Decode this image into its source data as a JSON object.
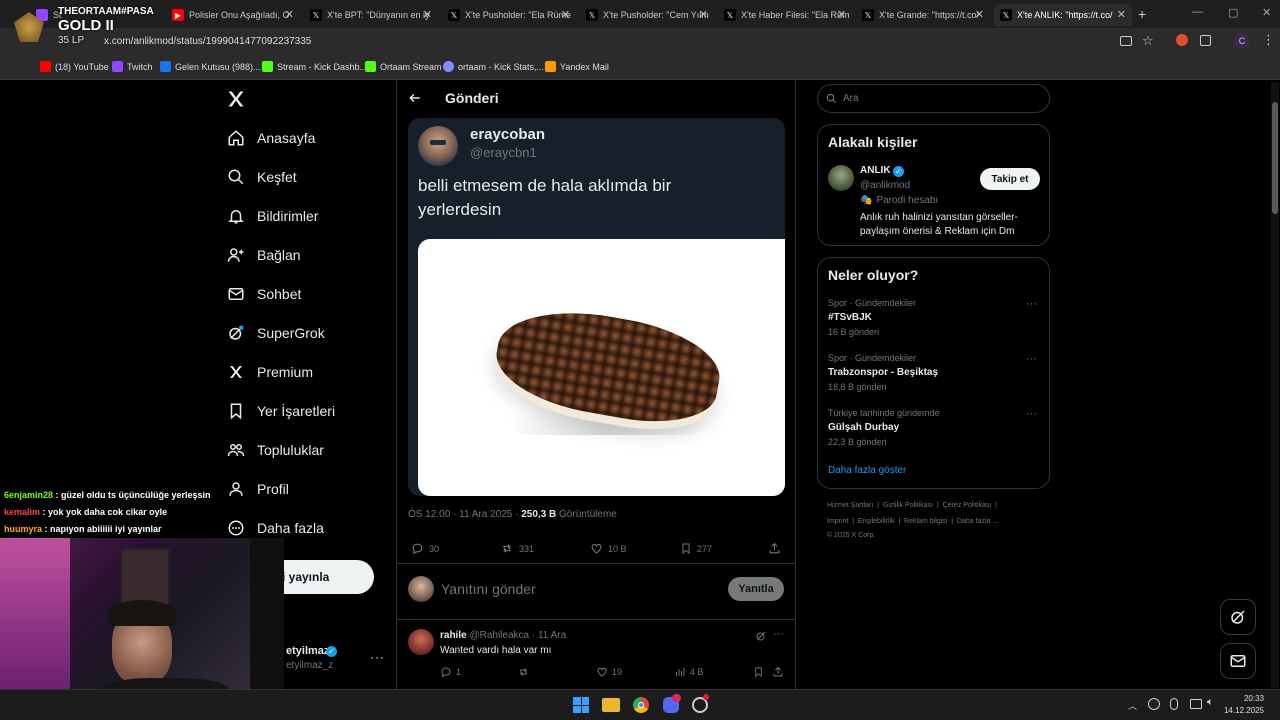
{
  "browser": {
    "tabs": [
      {
        "label": "St",
        "favicon_color": "#9146ff"
      },
      {
        "label": "Polisler Onu Aşağıladı, O",
        "favicon_color": "#ff0000"
      },
      {
        "label": "X'te BPT: \"Dünyanın en iy",
        "favicon_color": "#000000"
      },
      {
        "label": "X'te Pusholder: \"Ela Rüme",
        "favicon_color": "#000000"
      },
      {
        "label": "X'te Pusholder: \"Cem Yılm",
        "favicon_color": "#000000"
      },
      {
        "label": "X'te Haber Filesi: \"Ela Rüm",
        "favicon_color": "#000000"
      },
      {
        "label": "X'te Grande: \"https://t.co/",
        "favicon_color": "#000000"
      },
      {
        "label": "X'te ANLIK: \"https://t.co/",
        "favicon_color": "#000000"
      }
    ],
    "url": "x.com/anlikmod/status/1999041477092237335",
    "bookmarks": [
      {
        "label": "(18) YouTube",
        "color": "#ff0000"
      },
      {
        "label": "Twitch",
        "color": "#9146ff"
      },
      {
        "label": "Gelen Kutusu (988)...",
        "color": "#1a73e8"
      },
      {
        "label": "Stream - Kick Dashb...",
        "color": "#53fc18"
      },
      {
        "label": "Ortaam Stream",
        "color": "#53fc18"
      },
      {
        "label": "ortaam - Kick Stats,...",
        "color": "#8888ff"
      },
      {
        "label": "Yandex Mail",
        "color": "#ff9900"
      }
    ]
  },
  "stream_overlay": {
    "streamer": "THEORTAAM#PASA",
    "rank": "GOLD II",
    "lp": "35 LP",
    "chat": [
      {
        "user": "6enjamin28",
        "user_color": "#7CFC00",
        "message": "güzel oldu ts üçüncülüğe yerleşsin"
      },
      {
        "user": "kemalim",
        "user_color": "#ff4040",
        "message": "yok yok daha cok cikar oyle"
      },
      {
        "user": "huumyra",
        "user_color": "#ffb000",
        "message": "napıyon abiiiiii iyi yayınlar"
      }
    ]
  },
  "sidebar": {
    "items": [
      {
        "label": "Anasayfa",
        "icon": "home-icon"
      },
      {
        "label": "Keşfet",
        "icon": "search-icon"
      },
      {
        "label": "Bildirimler",
        "icon": "bell-icon"
      },
      {
        "label": "Bağlan",
        "icon": "person-add-icon"
      },
      {
        "label": "Sohbet",
        "icon": "mail-icon"
      },
      {
        "label": "SuperGrok",
        "icon": "grok-icon"
      },
      {
        "label": "Premium",
        "icon": "x-logo-icon"
      },
      {
        "label": "Yer İşaretleri",
        "icon": "bookmark-icon"
      },
      {
        "label": "Topluluklar",
        "icon": "communities-icon"
      },
      {
        "label": "Profil",
        "icon": "profile-icon"
      },
      {
        "label": "Daha fazla",
        "icon": "more-circle-icon"
      }
    ],
    "post_button": "eri yayınla",
    "account_name": "etyilmaz",
    "account_handle": "etyilmaz_z"
  },
  "post": {
    "header": "Gönderi",
    "author_name": "eraycoban",
    "author_handle": "@eraycbn1",
    "text": "belli etmesem de hala aklımda bir yerlerdesin",
    "time": "ÖS 12:00 · 11 Ara 2025 · ",
    "views": "250,3 B",
    "views_label": "Görüntüleme",
    "replies": "30",
    "reposts": "331",
    "likes": "10 B",
    "bookmarks": "277",
    "reply_placeholder": "Yanıtını gönder",
    "reply_button": "Yanıtla"
  },
  "reply": {
    "name": "rahile",
    "handle": "@Rahileakca",
    "date": "· 11 Ara",
    "text": "Wanted vardı hala var mı",
    "replies": "1",
    "likes": "19",
    "views": "4 B"
  },
  "right": {
    "search_placeholder": "Ara",
    "related_title": "Alakalı kişiler",
    "person_name": "ANLIK",
    "person_handle": "@anlikmod",
    "person_label": "Parodi hesabı",
    "person_bio": "Anlık ruh halinizi yansıtan görseller- paylaşım önerisi & Reklam için Dm",
    "follow_button": "Takip et",
    "trends_title": "Neler oluyor?",
    "trends": [
      {
        "category": "Spor · Gündemdekiler",
        "name": "#TSvBJK",
        "count": "16 B gönderi"
      },
      {
        "category": "Spor · Gündemdekiler",
        "name": "Trabzonspor - Beşiktaş",
        "count": "18,8 B gönderi"
      },
      {
        "category": "Türkiye tarihinde gündemde",
        "name": "Gülşah Durbay",
        "count": "22,3 B gönderi"
      }
    ],
    "show_more": "Daha fazla göster",
    "footer_line1": "Hizmet Şartları  |  Gizlilik Politikası  |  Çerez Politikası  |",
    "footer_line2": "Imprint  |  Erişilebilirlik  |  Reklam bilgisi  |  Daha fazla ...",
    "footer_line3": "© 2025 X Corp."
  },
  "taskbar": {
    "time": "20:33",
    "date": "14.12.2025"
  }
}
